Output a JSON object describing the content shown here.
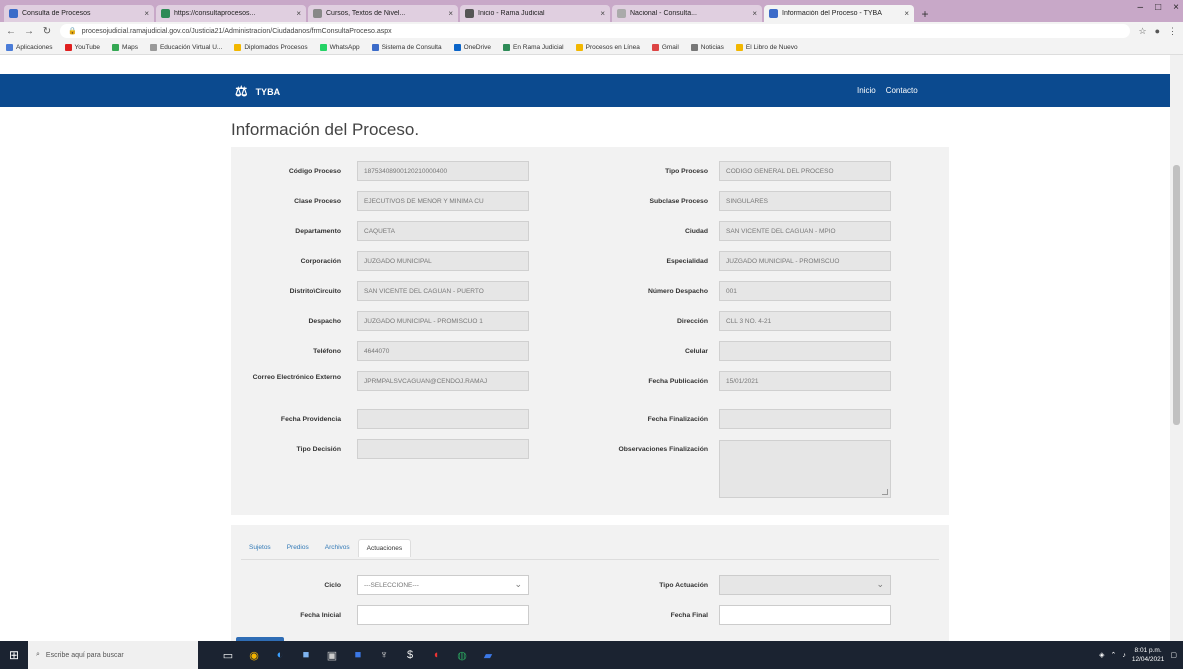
{
  "browser": {
    "tabs": [
      {
        "label": "Consulta de Procesos"
      },
      {
        "label": "https://consultaprocesos..."
      },
      {
        "label": "Cursos, Textos de Nivel..."
      },
      {
        "label": "Inicio - Rama Judicial"
      },
      {
        "label": "Nacional - Consulta..."
      },
      {
        "label": "Información del Proceso - TYBA"
      }
    ],
    "url": "procesojudicial.ramajudicial.gov.co/Justicia21/Administracion/Ciudadanos/frmConsultaProceso.aspx",
    "bookmarks": [
      "Aplicaciones",
      "YouTube",
      "Maps",
      "Educación Virtual U...",
      "Diplomados Procesos",
      "WhatsApp",
      "Sistema de Consulta",
      "OneDrive",
      "En Rama Judicial",
      "Procesos en Línea",
      "Gmail",
      "Noticias",
      "El Libro de Nuevo"
    ]
  },
  "header": {
    "brand": "TYBA",
    "nav": [
      "Inicio",
      "Contacto"
    ]
  },
  "page": {
    "title": "Información del Proceso."
  },
  "form": {
    "rows": [
      {
        "l1": "Código Proceso",
        "v1": "18753408900120210000400",
        "l2": "Tipo Proceso",
        "v2": "CODIGO GENERAL DEL PROCESO"
      },
      {
        "l1": "Clase Proceso",
        "v1": "EJECUTIVOS DE MENOR Y MINIMA CU",
        "l2": "Subclase Proceso",
        "v2": "SINGULARES"
      },
      {
        "l1": "Departamento",
        "v1": "CAQUETA",
        "l2": "Ciudad",
        "v2": "SAN VICENTE DEL CAGUAN - MPIO"
      },
      {
        "l1": "Corporación",
        "v1": "JUZGADO MUNICIPAL",
        "l2": "Especialidad",
        "v2": "JUZGADO MUNICIPAL - PROMISCUO"
      },
      {
        "l1": "Distrito\\Circuito",
        "v1": "SAN VICENTE DEL CAGUAN - PUERTO",
        "l2": "Número Despacho",
        "v2": "001"
      },
      {
        "l1": "Despacho",
        "v1": "JUZGADO MUNICIPAL - PROMISCUO 1",
        "l2": "Dirección",
        "v2": "CLL 3 NO. 4-21"
      },
      {
        "l1": "Teléfono",
        "v1": "4644070",
        "l2": "Celular",
        "v2": ""
      },
      {
        "l1": "Correo Electrónico Externo",
        "v1": "JPRMPALSVCAGUAN@CENDOJ.RAMAJ",
        "l2": "Fecha Publicación",
        "v2": "15/01/2021"
      },
      {
        "l1": "Fecha Providencia",
        "v1": "",
        "l2": "Fecha Finalización",
        "v2": ""
      },
      {
        "l1": "Tipo Decisión",
        "v1": "",
        "l2": "Observaciones Finalización",
        "v2": ""
      }
    ]
  },
  "tabs": {
    "items": [
      "Sujetos",
      "Predios",
      "Archivos",
      "Actuaciones"
    ],
    "active": "Actuaciones"
  },
  "filters": {
    "ciclo_label": "Ciclo",
    "ciclo_value": "---SELECCIONE---",
    "tipo_label": "Tipo Actuación",
    "tipo_value": "",
    "fecha_inicial_label": "Fecha Inicial",
    "fecha_final_label": "Fecha Final"
  },
  "taskbar": {
    "search_placeholder": "Escribe aquí para buscar",
    "time": "8:01 p.m.",
    "date": "12/04/2021"
  }
}
